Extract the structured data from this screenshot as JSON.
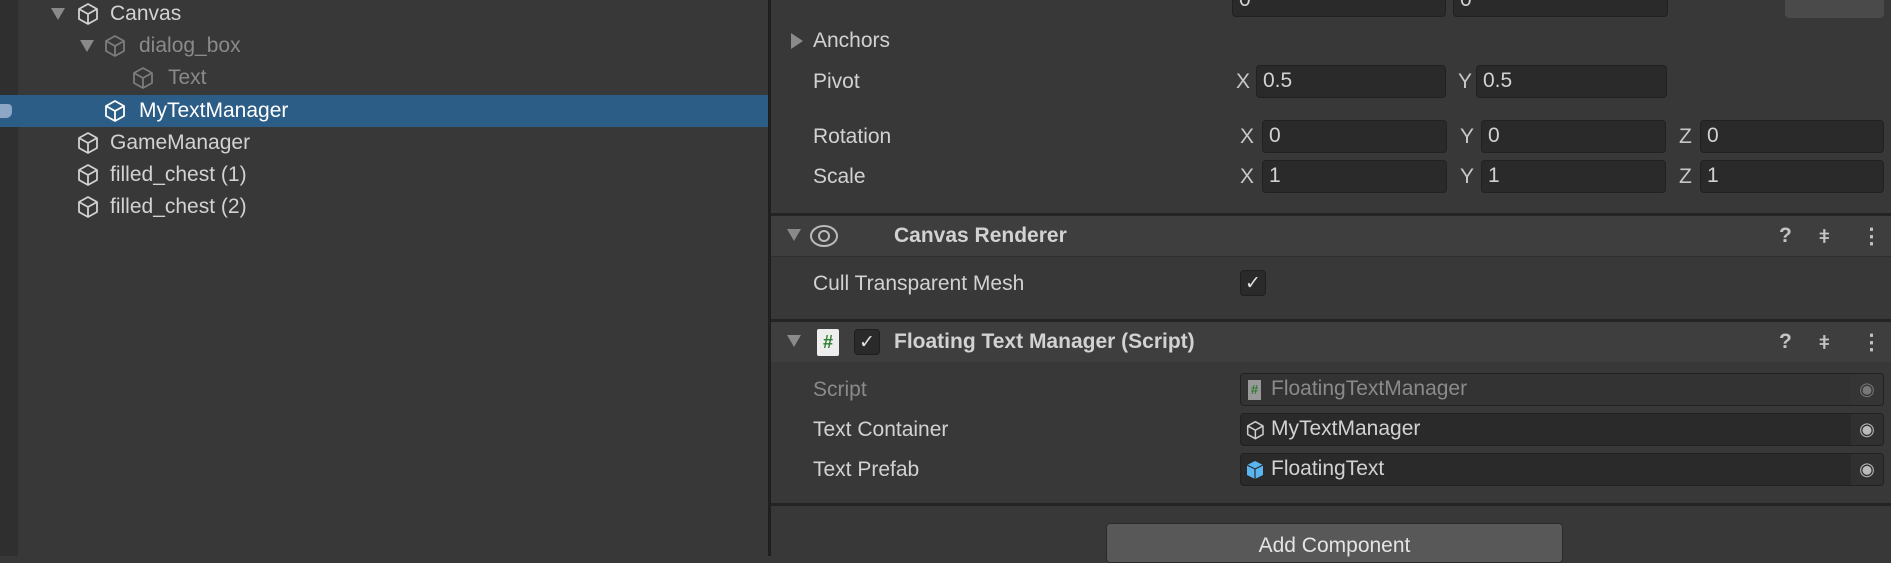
{
  "hierarchy": {
    "items": [
      {
        "label": "Canvas",
        "expanded": true,
        "dimmed": false,
        "selected": false
      },
      {
        "label": "dialog_box",
        "expanded": true,
        "dimmed": true,
        "selected": false
      },
      {
        "label": "Text",
        "dimmed": true,
        "selected": false
      },
      {
        "label": "MyTextManager",
        "dimmed": false,
        "selected": true
      },
      {
        "label": "GameManager",
        "dimmed": false,
        "selected": false
      },
      {
        "label": "filled_chest (1)",
        "dimmed": false,
        "selected": false
      },
      {
        "label": "filled_chest (2)",
        "dimmed": false,
        "selected": false
      }
    ]
  },
  "inspector": {
    "top_row": {
      "values": [
        "0",
        "0"
      ]
    },
    "anchors": {
      "label": "Anchors"
    },
    "pivot": {
      "label": "Pivot",
      "x_label": "X",
      "x": "0.5",
      "y_label": "Y",
      "y": "0.5"
    },
    "rotation": {
      "label": "Rotation",
      "x_label": "X",
      "x": "0",
      "y_label": "Y",
      "y": "0",
      "z_label": "Z",
      "z": "0"
    },
    "scale": {
      "label": "Scale",
      "x_label": "X",
      "x": "1",
      "y_label": "Y",
      "y": "1",
      "z_label": "Z",
      "z": "1"
    },
    "canvas_renderer": {
      "title": "Canvas Renderer",
      "cull_label": "Cull Transparent Mesh",
      "cull_checked": true
    },
    "floating_text_manager": {
      "title": "Floating Text Manager (Script)",
      "enabled": true,
      "script_label": "Script",
      "script_value": "FloatingTextManager",
      "container_label": "Text Container",
      "container_value": "MyTextManager",
      "prefab_label": "Text Prefab",
      "prefab_value": "FloatingText"
    },
    "add_component": "Add Component"
  },
  "colors": {
    "selection": "#2c5d87",
    "prefab_icon": "#5ab4f0",
    "script_hash": "#2e7d32"
  }
}
